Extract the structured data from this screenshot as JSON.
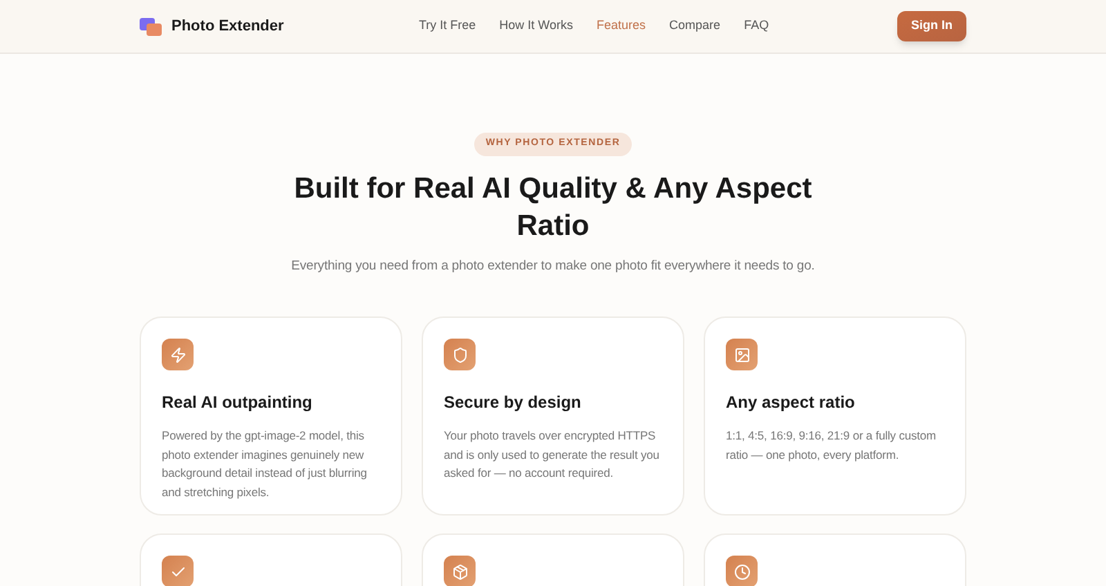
{
  "brand": {
    "name": "Photo Extender"
  },
  "nav": [
    {
      "label": "Try It Free",
      "selected": false
    },
    {
      "label": "How It Works",
      "selected": false
    },
    {
      "label": "Features",
      "selected": true
    },
    {
      "label": "Compare",
      "selected": false
    },
    {
      "label": "FAQ",
      "selected": false
    }
  ],
  "sign_in": "Sign In",
  "section": {
    "eyebrow": "WHY PHOTO EXTENDER",
    "title": "Built for Real AI Quality & Any Aspect Ratio",
    "subtitle": "Everything you need from a photo extender to make one photo fit everywhere it needs to go."
  },
  "features": [
    {
      "kind": "full",
      "title": "Real AI outpainting",
      "text": "Powered by the gpt-image-2 model, this photo extender imagines genuinely new background detail instead of just blurring and stretching pixels."
    },
    {
      "kind": "full",
      "title": "Secure by design",
      "text": "Your photo travels over encrypted HTTPS and is only used to generate the result you asked for — no account required."
    },
    {
      "kind": "full",
      "title": "Any aspect ratio",
      "text": "1:1, 4:5, 16:9, 9:16, 21:9 or a fully custom ratio — one photo, every platform."
    },
    {
      "kind": "partial"
    },
    {
      "kind": "partial"
    },
    {
      "kind": "partial"
    }
  ]
}
